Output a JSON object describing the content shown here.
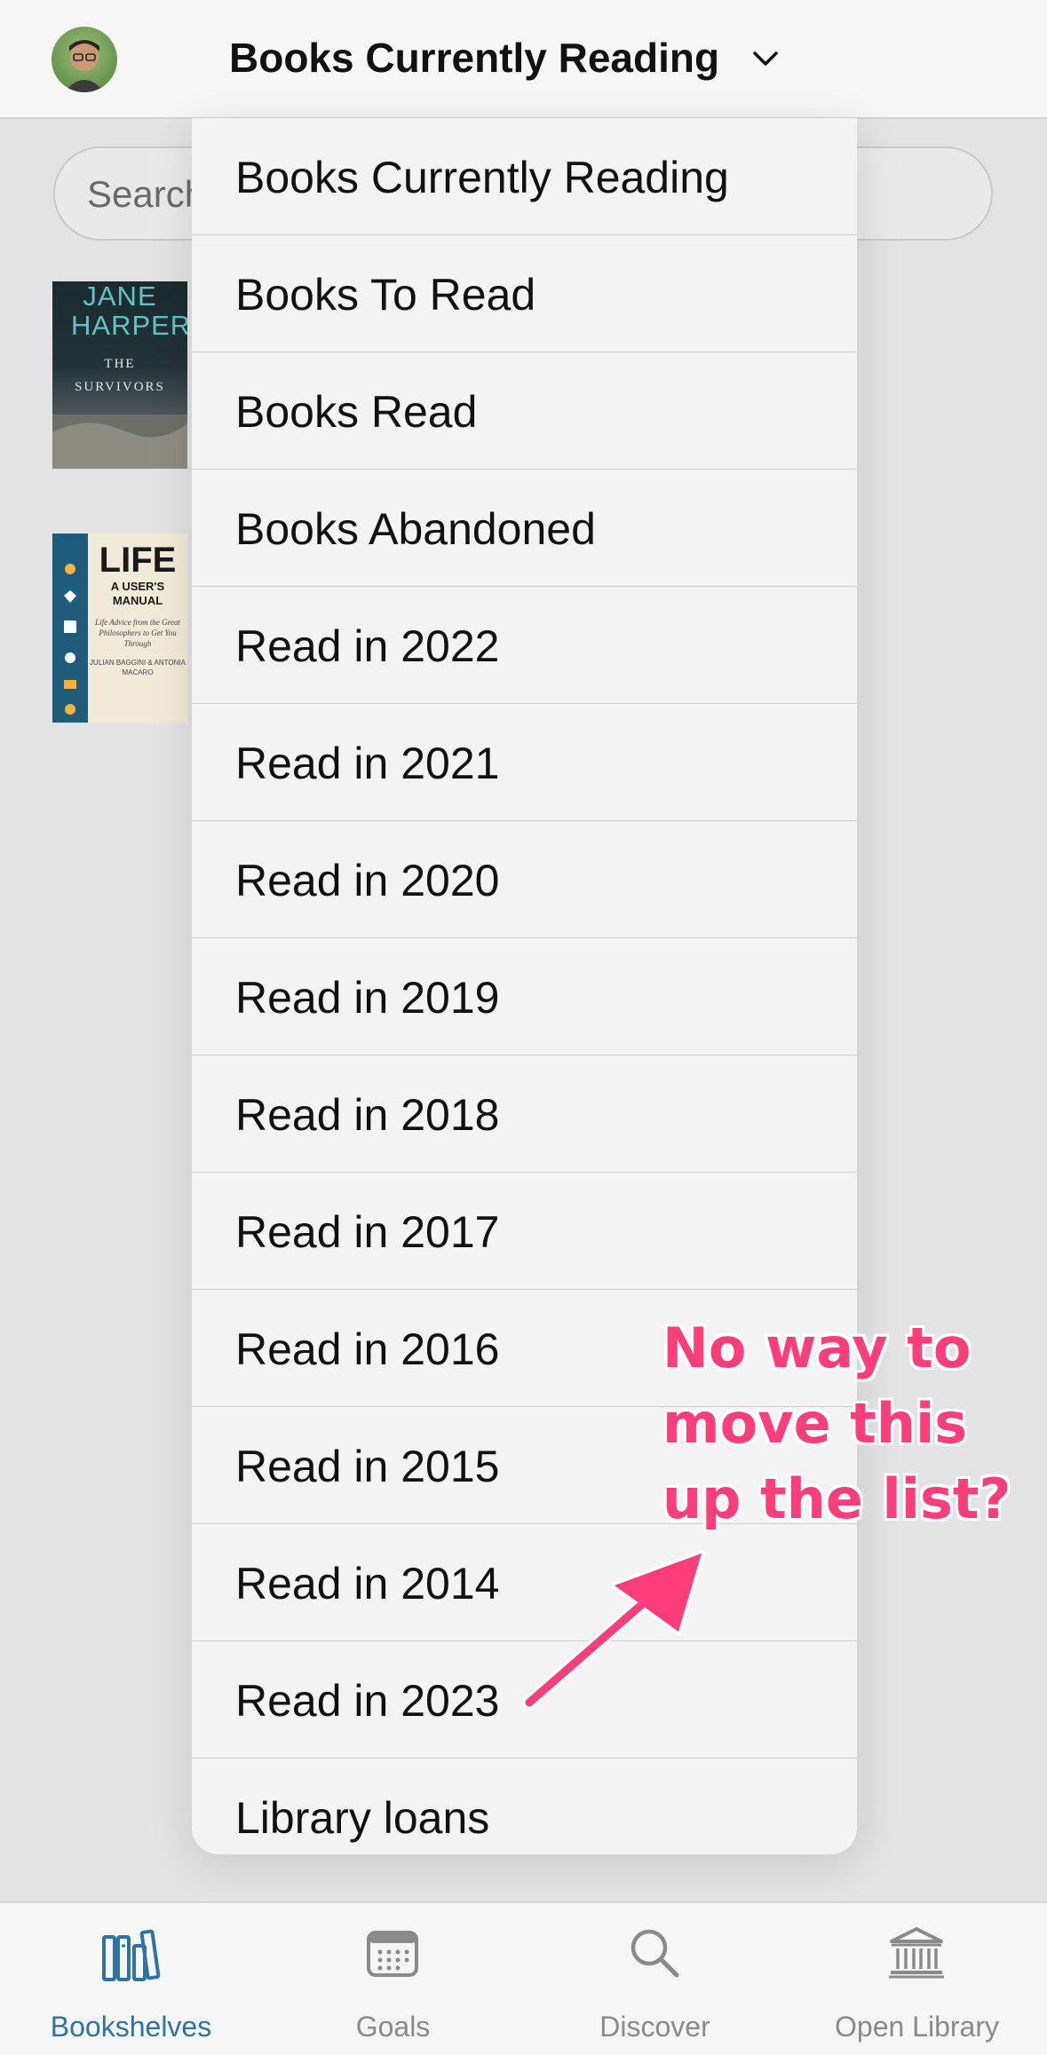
{
  "header": {
    "title": "Books Currently Reading"
  },
  "search": {
    "placeholder": "Search"
  },
  "dropdown": {
    "items": [
      "Books Currently Reading",
      "Books To Read",
      "Books Read",
      "Books Abandoned",
      "Read in 2022",
      "Read in 2021",
      "Read in 2020",
      "Read in 2019",
      "Read in 2018",
      "Read in 2017",
      "Read in 2016",
      "Read in 2015",
      "Read in 2014",
      "Read in 2023",
      "Library loans"
    ]
  },
  "books": [
    {
      "author": "JANE HARPER",
      "title": "THE SURVIVORS"
    },
    {
      "title": "LIFE",
      "subtitle": "A USER'S MANUAL",
      "tagline": "Life Advice from the Great Philosophers to Get You Through",
      "authors": "JULIAN BAGGINI & ANTONIA MACARO"
    }
  ],
  "annotation": {
    "line1": "No way to",
    "line2": "move this",
    "line3": "up the list?",
    "color": "#ff3d7a"
  },
  "tabbar": {
    "accent": "#2f72a4",
    "tabs": [
      {
        "label": "Bookshelves",
        "icon": "bookshelves-icon",
        "active": true
      },
      {
        "label": "Goals",
        "icon": "calendar-icon",
        "active": false
      },
      {
        "label": "Discover",
        "icon": "search-icon",
        "active": false
      },
      {
        "label": "Open Library",
        "icon": "library-building-icon",
        "active": false
      }
    ]
  }
}
